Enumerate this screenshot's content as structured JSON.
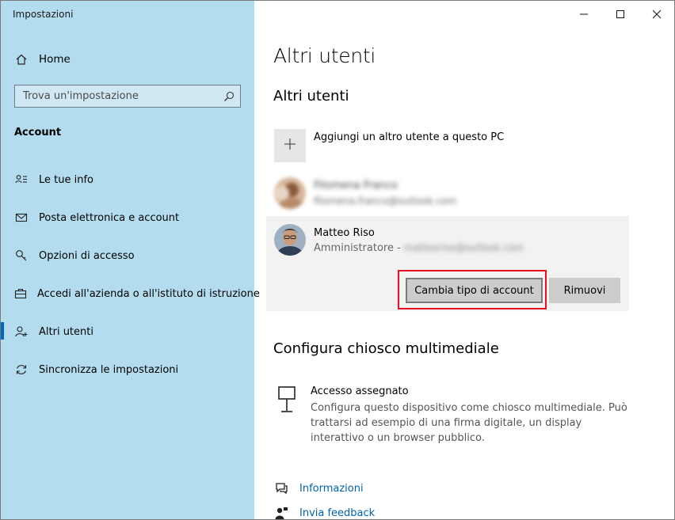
{
  "window": {
    "app_title": "Impostazioni"
  },
  "sidebar": {
    "home_label": "Home",
    "search_placeholder": "Trova un'impostazione",
    "section_label": "Account",
    "items": [
      {
        "label": "Le tue info",
        "icon": "contact-info-icon"
      },
      {
        "label": "Posta elettronica e account",
        "icon": "mail-icon"
      },
      {
        "label": "Opzioni di accesso",
        "icon": "key-icon"
      },
      {
        "label": "Accedi all'azienda o all'istituto di istruzione",
        "icon": "briefcase-icon"
      },
      {
        "label": "Altri utenti",
        "icon": "add-person-icon",
        "selected": true
      },
      {
        "label": "Sincronizza le impostazioni",
        "icon": "sync-icon"
      }
    ]
  },
  "main": {
    "page_title": "Altri utenti",
    "section_title": "Altri utenti",
    "add_user_label": "Aggiungi un altro utente a questo PC",
    "users": [
      {
        "name": "Filomena Franco",
        "email": "filomena.franco@outlook.com",
        "blurred": true
      },
      {
        "name": "Matteo Riso",
        "role": "Amministratore -",
        "email": "matteoriso@outlook.com",
        "email_blurred": true
      }
    ],
    "change_type_label": "Cambia tipo di account",
    "remove_label": "Rimuovi",
    "kiosk_title": "Configura chiosco multimediale",
    "kiosk_item_name": "Accesso assegnato",
    "kiosk_item_desc": "Configura questo dispositivo come chiosco multimediale. Può trattarsi ad esempio di una firma digitale, un display interattivo o un browser pubblico.",
    "help_links": [
      {
        "label": "Informazioni",
        "icon": "chat-help-icon"
      },
      {
        "label": "Invia feedback",
        "icon": "feedback-icon"
      }
    ]
  },
  "colors": {
    "sidebar_bg": "#b3dcee",
    "accent": "#0067c0",
    "link": "#0063b1",
    "highlight_box": "#e81123",
    "panel_bg": "#f2f2f2"
  }
}
